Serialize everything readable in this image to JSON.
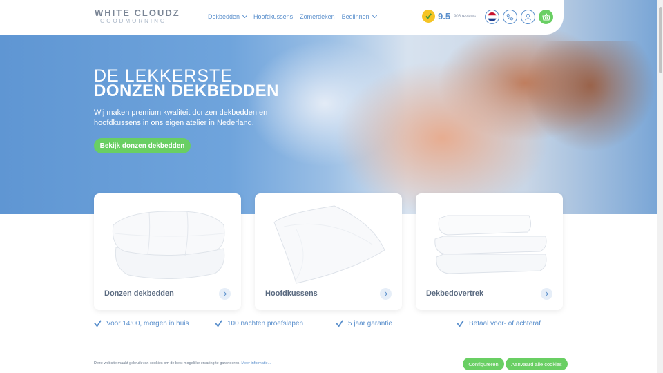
{
  "header": {
    "logo": {
      "main": "WHITE CLOUDZ",
      "sub": "GOODMORNING"
    },
    "nav": [
      {
        "label": "Dekbedden",
        "dropdown": true
      },
      {
        "label": "Hoofdkussens",
        "dropdown": false
      },
      {
        "label": "Zomerdeken",
        "dropdown": false
      },
      {
        "label": "Bedlinnen",
        "dropdown": true
      }
    ],
    "rating": {
      "value": "9.5",
      "reviews": "906 reviews",
      "icon": "check-seal-icon"
    },
    "icons": [
      "dutch-flag-icon",
      "phone-icon",
      "user-icon",
      "basket-icon"
    ]
  },
  "hero": {
    "title_line1": "DE LEKKERSTE",
    "title_line2": "DONZEN DEKBEDDEN",
    "text": "Wij maken premium kwaliteit donzen dekbedden en hoofdkussens in ons eigen atelier in Nederland.",
    "button": "Bekijk donzen dekbedden"
  },
  "cards": [
    {
      "label": "Donzen dekbedden",
      "icon": "duvet-image"
    },
    {
      "label": "Hoofdkussens",
      "icon": "pillow-image"
    },
    {
      "label": "Dekbedovertrek",
      "icon": "folded-sheets-image"
    }
  ],
  "usps": [
    "Voor 14:00, morgen in huis",
    "100 nachten proefslapen",
    "5 jaar garantie",
    "Betaal voor- of achteraf"
  ],
  "cookie": {
    "text": "Deze website maakt gebruik van cookies om de best mogelijke ervaring te garanderen.",
    "link": "Meer informatie...",
    "configure": "Configureren",
    "accept": "Aanvaard alle cookies"
  },
  "colors": {
    "accent": "#5a8fcc",
    "green": "#69cf63",
    "text": "#5a6a80"
  }
}
